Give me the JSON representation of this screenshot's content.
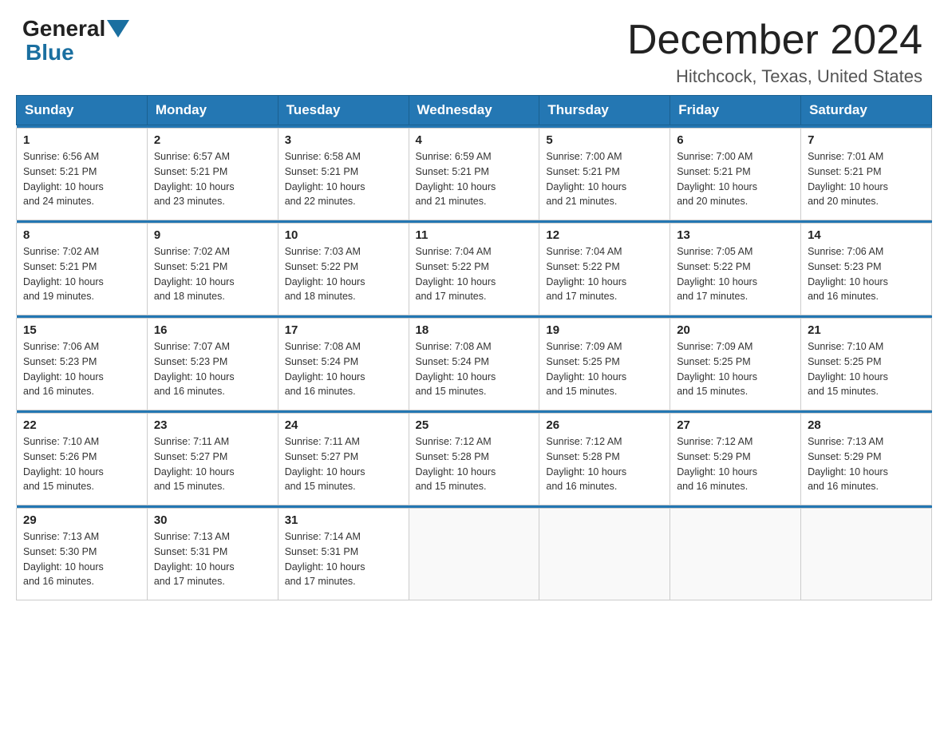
{
  "header": {
    "logo_general": "General",
    "logo_blue": "Blue",
    "month_title": "December 2024",
    "location": "Hitchcock, Texas, United States"
  },
  "days_of_week": [
    "Sunday",
    "Monday",
    "Tuesday",
    "Wednesday",
    "Thursday",
    "Friday",
    "Saturday"
  ],
  "weeks": [
    [
      {
        "day": "1",
        "sunrise": "6:56 AM",
        "sunset": "5:21 PM",
        "daylight": "10 hours and 24 minutes."
      },
      {
        "day": "2",
        "sunrise": "6:57 AM",
        "sunset": "5:21 PM",
        "daylight": "10 hours and 23 minutes."
      },
      {
        "day": "3",
        "sunrise": "6:58 AM",
        "sunset": "5:21 PM",
        "daylight": "10 hours and 22 minutes."
      },
      {
        "day": "4",
        "sunrise": "6:59 AM",
        "sunset": "5:21 PM",
        "daylight": "10 hours and 21 minutes."
      },
      {
        "day": "5",
        "sunrise": "7:00 AM",
        "sunset": "5:21 PM",
        "daylight": "10 hours and 21 minutes."
      },
      {
        "day": "6",
        "sunrise": "7:00 AM",
        "sunset": "5:21 PM",
        "daylight": "10 hours and 20 minutes."
      },
      {
        "day": "7",
        "sunrise": "7:01 AM",
        "sunset": "5:21 PM",
        "daylight": "10 hours and 20 minutes."
      }
    ],
    [
      {
        "day": "8",
        "sunrise": "7:02 AM",
        "sunset": "5:21 PM",
        "daylight": "10 hours and 19 minutes."
      },
      {
        "day": "9",
        "sunrise": "7:02 AM",
        "sunset": "5:21 PM",
        "daylight": "10 hours and 18 minutes."
      },
      {
        "day": "10",
        "sunrise": "7:03 AM",
        "sunset": "5:22 PM",
        "daylight": "10 hours and 18 minutes."
      },
      {
        "day": "11",
        "sunrise": "7:04 AM",
        "sunset": "5:22 PM",
        "daylight": "10 hours and 17 minutes."
      },
      {
        "day": "12",
        "sunrise": "7:04 AM",
        "sunset": "5:22 PM",
        "daylight": "10 hours and 17 minutes."
      },
      {
        "day": "13",
        "sunrise": "7:05 AM",
        "sunset": "5:22 PM",
        "daylight": "10 hours and 17 minutes."
      },
      {
        "day": "14",
        "sunrise": "7:06 AM",
        "sunset": "5:23 PM",
        "daylight": "10 hours and 16 minutes."
      }
    ],
    [
      {
        "day": "15",
        "sunrise": "7:06 AM",
        "sunset": "5:23 PM",
        "daylight": "10 hours and 16 minutes."
      },
      {
        "day": "16",
        "sunrise": "7:07 AM",
        "sunset": "5:23 PM",
        "daylight": "10 hours and 16 minutes."
      },
      {
        "day": "17",
        "sunrise": "7:08 AM",
        "sunset": "5:24 PM",
        "daylight": "10 hours and 16 minutes."
      },
      {
        "day": "18",
        "sunrise": "7:08 AM",
        "sunset": "5:24 PM",
        "daylight": "10 hours and 15 minutes."
      },
      {
        "day": "19",
        "sunrise": "7:09 AM",
        "sunset": "5:25 PM",
        "daylight": "10 hours and 15 minutes."
      },
      {
        "day": "20",
        "sunrise": "7:09 AM",
        "sunset": "5:25 PM",
        "daylight": "10 hours and 15 minutes."
      },
      {
        "day": "21",
        "sunrise": "7:10 AM",
        "sunset": "5:25 PM",
        "daylight": "10 hours and 15 minutes."
      }
    ],
    [
      {
        "day": "22",
        "sunrise": "7:10 AM",
        "sunset": "5:26 PM",
        "daylight": "10 hours and 15 minutes."
      },
      {
        "day": "23",
        "sunrise": "7:11 AM",
        "sunset": "5:27 PM",
        "daylight": "10 hours and 15 minutes."
      },
      {
        "day": "24",
        "sunrise": "7:11 AM",
        "sunset": "5:27 PM",
        "daylight": "10 hours and 15 minutes."
      },
      {
        "day": "25",
        "sunrise": "7:12 AM",
        "sunset": "5:28 PM",
        "daylight": "10 hours and 15 minutes."
      },
      {
        "day": "26",
        "sunrise": "7:12 AM",
        "sunset": "5:28 PM",
        "daylight": "10 hours and 16 minutes."
      },
      {
        "day": "27",
        "sunrise": "7:12 AM",
        "sunset": "5:29 PM",
        "daylight": "10 hours and 16 minutes."
      },
      {
        "day": "28",
        "sunrise": "7:13 AM",
        "sunset": "5:29 PM",
        "daylight": "10 hours and 16 minutes."
      }
    ],
    [
      {
        "day": "29",
        "sunrise": "7:13 AM",
        "sunset": "5:30 PM",
        "daylight": "10 hours and 16 minutes."
      },
      {
        "day": "30",
        "sunrise": "7:13 AM",
        "sunset": "5:31 PM",
        "daylight": "10 hours and 17 minutes."
      },
      {
        "day": "31",
        "sunrise": "7:14 AM",
        "sunset": "5:31 PM",
        "daylight": "10 hours and 17 minutes."
      },
      null,
      null,
      null,
      null
    ]
  ],
  "labels": {
    "sunrise": "Sunrise:",
    "sunset": "Sunset:",
    "daylight": "Daylight:"
  }
}
